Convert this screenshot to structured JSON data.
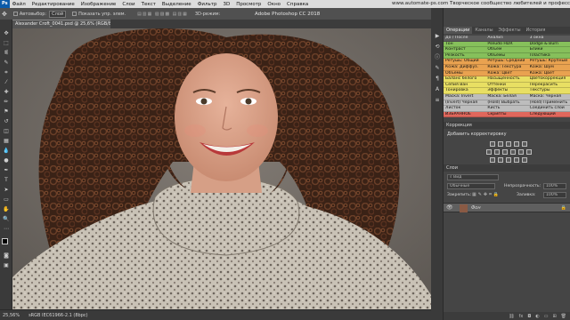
{
  "menubar": {
    "app_badge": "Ps",
    "items": [
      "Файл",
      "Редактирование",
      "Изображение",
      "Слои",
      "Текст",
      "Выделение",
      "Фильтр",
      "3D",
      "Просмотр",
      "Окно",
      "Справка"
    ],
    "site_text": "www.automate-ps.com  Творческое сообщество любителей и профессионалов Photoshop"
  },
  "options": {
    "autoselect_label": "Автовыбор:",
    "autoselect_value": "Слой",
    "show_transform_label": "Показать упр. элем.",
    "mode_3d_label": "3D-режим:",
    "window_title": "Adobe Photoshop CC 2018"
  },
  "document": {
    "tab_title": "Alexander Croft_0041.psd @ 25,6% (RGB/8) *"
  },
  "status": {
    "zoom": "25,56%",
    "profile": "sRGB IEC61966-2.1 (8bpc)"
  },
  "panels": {
    "top_tabs": [
      "Операции",
      "Каналы",
      "Эффекты",
      "История"
    ],
    "actions_header": [
      "До / После",
      "F2",
      "Анализ",
      "F3",
      "3 окна",
      "F4"
    ],
    "action_rows": [
      {
        "color": "gray",
        "cells": [
          "До / После",
          "Анализ",
          "3 окна"
        ]
      },
      {
        "color": "green",
        "cells": [
          "Тон",
          "Pseudo HDR",
          "Dodge & Burn"
        ]
      },
      {
        "color": "green",
        "cells": [
          "Контраст",
          "Объём",
          "Блики"
        ]
      },
      {
        "color": "green",
        "cells": [
          "Резкость",
          "Объёмы",
          "Пластика"
        ]
      },
      {
        "color": "orange",
        "cells": [
          "Ретушь: Общий",
          "Ретушь: Средний",
          "Ретушь: Крупный"
        ]
      },
      {
        "color": "orange",
        "cells": [
          "Кожа: Диффуз.",
          "Кожа: Текстура",
          "Кожа: Шум"
        ]
      },
      {
        "color": "orange",
        "cells": [
          "Объёмы",
          "Кожа: Цвет",
          "Кожа: Цвет"
        ]
      },
      {
        "color": "yellow",
        "cells": [
          "Баланс белого",
          "Насыщенность",
          "Цветокоррекция"
        ]
      },
      {
        "color": "yellow",
        "cells": [
          "Сепия Ван",
          "Оттенки",
          "Перекрасить"
        ]
      },
      {
        "color": "yellow",
        "cells": [
          "Тонировка",
          "Эффекты",
          "Текстуры"
        ]
      },
      {
        "color": "silver",
        "cells": [
          "Маска: Invert",
          "Маска: Белая",
          "Маска: Чёрная"
        ]
      },
      {
        "color": "silver",
        "cells": [
          "(Invert) Чёрная",
          "(Hold) Выбрать",
          "(Hold) Применить"
        ]
      },
      {
        "color": "silver",
        "cells": [
          "Листок",
          "Кисть",
          "Соединить слои"
        ]
      },
      {
        "color": "red",
        "cells": [
          "ИЗБРАННОЕ",
          "Скрипты",
          "Следующий"
        ]
      }
    ],
    "correction_title": "Коррекция",
    "correction_subtitle": "Добавить корректировку",
    "layers_title": "Слои",
    "layers_filter": "Вид",
    "layers_blend": "Обычные",
    "layers_opacity_label": "Непрозрачность:",
    "layers_opacity_value": "100%",
    "layers_lock_label": "Закрепить:",
    "layers_fill_label": "Заливка:",
    "layers_fill_value": "100%",
    "layer_name": "Фон"
  },
  "colors": {
    "green": "#86c05b",
    "orange": "#e9a250",
    "yellow": "#e8df63",
    "red": "#e0675c",
    "silver": "#bdbdbd",
    "gray": "#9a9a9a"
  }
}
